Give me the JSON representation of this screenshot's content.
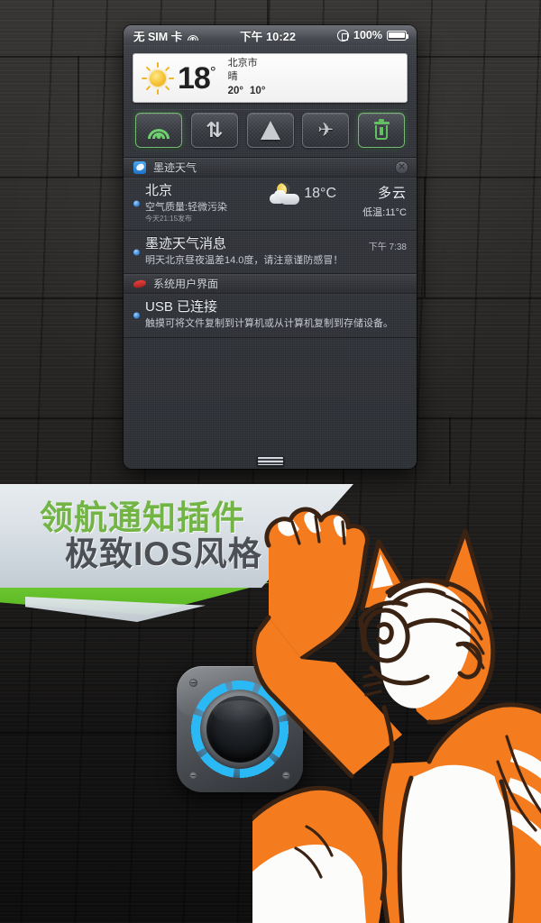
{
  "status_bar": {
    "carrier": "无 SIM 卡",
    "wifi_icon": "wifi-icon",
    "time": "下午 10:22",
    "rotation_lock_icon": "rotation-lock-icon",
    "battery_percent": "100%",
    "battery_icon": "battery-icon"
  },
  "weather_widget": {
    "icon": "sun-icon",
    "temperature": "18",
    "degree": "°",
    "city": "北京市",
    "condition": "晴",
    "high": "20°",
    "low": "10°"
  },
  "toggles": [
    {
      "name": "wifi-toggle",
      "icon": "wifi-icon",
      "label": "WiFi",
      "active": true
    },
    {
      "name": "data-toggle",
      "icon": "data-icon",
      "label": "数据",
      "glyph": "⇅",
      "active": false
    },
    {
      "name": "location-toggle",
      "icon": "location-icon",
      "label": "定位",
      "active": false
    },
    {
      "name": "airplane-toggle",
      "icon": "airplane-icon",
      "label": "飞行模式",
      "glyph": "✈",
      "active": false
    },
    {
      "name": "clear-toggle",
      "icon": "trash-icon",
      "label": "清除",
      "active": true
    }
  ],
  "notifications": {
    "groups": [
      {
        "app_name": "墨迹天气",
        "app_icon": "moji-weather-icon",
        "clear_label": "✕",
        "items": [
          {
            "title": "北京",
            "subtitle": "空气质量:轻微污染",
            "meta": "今天21:15发布",
            "weather_icon": "moon-cloud-icon",
            "temp": "18°C",
            "condition": "多云",
            "low": "低温:11°C"
          },
          {
            "title": "墨迹天气消息",
            "subtitle": "明天北京昼夜温差14.0度，请注意谨防感冒！",
            "time": "下午 7:38"
          }
        ]
      },
      {
        "app_name": "系统用户界面",
        "app_icon": "android-system-icon",
        "items": [
          {
            "title": "USB 已连接",
            "subtitle": "触摸可将文件复制到计算机或从计算机复制到存储设备。"
          }
        ]
      }
    ]
  },
  "shade_handle": "drag-handle",
  "banner": {
    "line1": "领航通知插件",
    "line2": "极致IOS风格",
    "line1_color": "#72b544",
    "line2_color": "#4c5055",
    "tail_color": "#62c028"
  },
  "app_icon": {
    "name": "navigation-app-icon",
    "accent_color": "#2bb9f5"
  },
  "mascot": {
    "name": "orange-tiger-mascot"
  }
}
